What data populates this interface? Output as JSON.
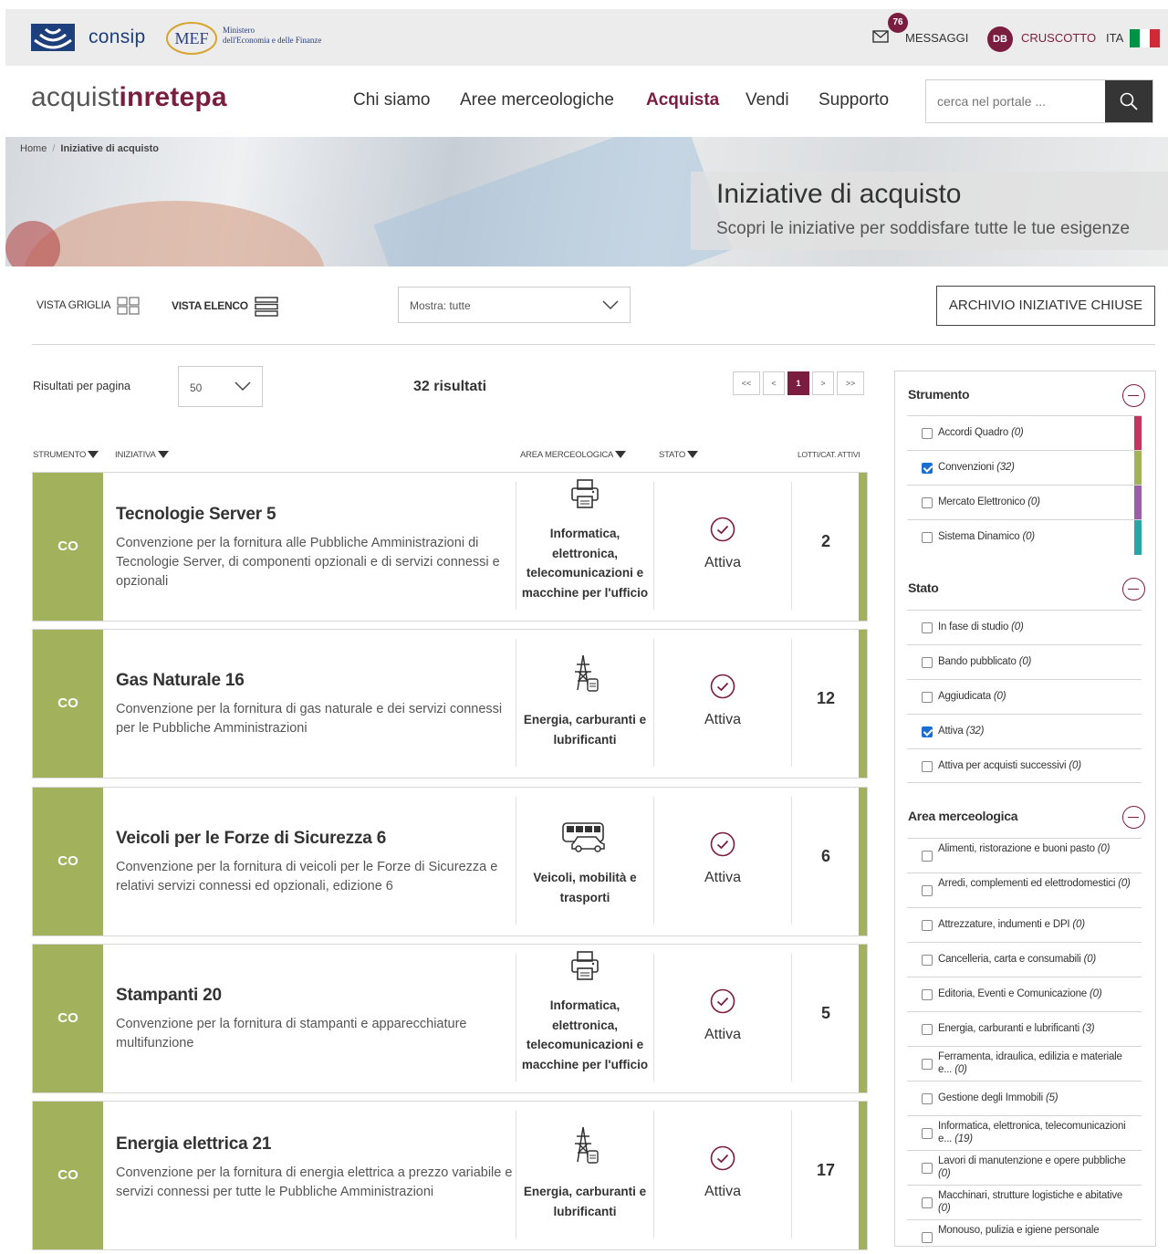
{
  "header": {
    "consip_text": "consip",
    "mef_abbr": "MEF",
    "mef_line1": "Ministero",
    "mef_line2": "dell'Economia e delle Finanze",
    "messages_count": "76",
    "messages_label": "MESSAGGI",
    "user_initials": "DB",
    "dashboard_label": "CRUSCOTTO",
    "language": "ITA",
    "flag_colors": [
      "#009246",
      "#ffffff",
      "#ce2b37"
    ]
  },
  "nav": {
    "brand_part1": "acquist",
    "brand_part2": "inrete",
    "brand_part3": "pa",
    "items": [
      {
        "label": "Chi siamo"
      },
      {
        "label": "Aree merceologiche"
      },
      {
        "label": "Acquista",
        "active": true
      },
      {
        "label": "Vendi"
      },
      {
        "label": "Supporto"
      }
    ],
    "search_placeholder": "cerca nel portale ..."
  },
  "breadcrumb": {
    "home": "Home",
    "current": "Iniziative di acquisto"
  },
  "hero": {
    "title": "Iniziative di acquisto",
    "subtitle": "Scopri le iniziative per soddisfare tutte le tue esigenze"
  },
  "toolbar": {
    "grid_view": "VISTA GRIGLIA",
    "list_view": "VISTA ELENCO",
    "show_select": "Mostra: tutte",
    "archive_button": "ARCHIVIO INIZIATIVE CHIUSE",
    "results_per_page_label": "Risultati per pagina",
    "results_per_page": "50",
    "results_count": "32 risultati",
    "pager": {
      "first": "<<",
      "prev": "<",
      "current": "1",
      "next": ">",
      "last": ">>"
    }
  },
  "columns": {
    "instrument": "STRUMENTO",
    "initiative": "INIZIATIVA",
    "area": "AREA MERCEOLOGICA",
    "status": "STATO",
    "lots": "LOTTI/CAT. ATTIVI"
  },
  "colors": {
    "accent": "#7a1d3e",
    "convenzioni": "#a2b25c",
    "accordi": "#c4365f",
    "mercato": "#9b5fa8",
    "sistema": "#2aa5a5"
  },
  "rows": [
    {
      "tag": "CO",
      "name": "Tecnologie Server 5",
      "desc": "Convenzione per la fornitura alle Pubbliche Amministrazioni di Tecnologie Server, di componenti opzionali e di servizi connessi e opzionali",
      "area": "Informatica, elettronica, telecomunicazioni e macchine per l'ufficio",
      "area_icon": "printer-icon",
      "status": "Attiva",
      "lots": "2"
    },
    {
      "tag": "CO",
      "name": "Gas Naturale 16",
      "desc": "Convenzione per la fornitura di gas naturale e dei servizi connessi per le Pubbliche Amministrazioni",
      "area": "Energia, carburanti e lubrificanti",
      "area_icon": "power-tower-icon",
      "status": "Attiva",
      "lots": "12"
    },
    {
      "tag": "CO",
      "name": "Veicoli per le Forze di Sicurezza 6",
      "desc": "Convenzione per la fornitura di veicoli per le Forze di Sicurezza e relativi servizi connessi ed opzionali, edizione 6",
      "area": "Veicoli, mobilità e trasporti",
      "area_icon": "bus-car-icon",
      "status": "Attiva",
      "lots": "6"
    },
    {
      "tag": "CO",
      "name": "Stampanti 20",
      "desc": "Convenzione per la fornitura di stampanti e apparecchiature multifunzione",
      "area": "Informatica, elettronica, telecomunicazioni e macchine per l'ufficio",
      "area_icon": "printer-icon",
      "status": "Attiva",
      "lots": "5"
    },
    {
      "tag": "CO",
      "name": "Energia elettrica 21",
      "desc": "Convenzione per la fornitura di energia elettrica a prezzo variabile e servizi connessi per tutte le Pubbliche Amministrazioni",
      "area": "Energia, carburanti e lubrificanti",
      "area_icon": "power-tower-icon",
      "status": "Attiva",
      "lots": "17"
    }
  ],
  "sidebar": {
    "instrument": {
      "title": "Strumento",
      "options": [
        {
          "label": "Accordi Quadro",
          "count": "(0)",
          "checked": false
        },
        {
          "label": "Convenzioni",
          "count": "(32)",
          "checked": true
        },
        {
          "label": "Mercato Elettronico",
          "count": "(0)",
          "checked": false
        },
        {
          "label": "Sistema Dinamico",
          "count": "(0)",
          "checked": false
        }
      ]
    },
    "status": {
      "title": "Stato",
      "options": [
        {
          "label": "In fase di studio",
          "count": "(0)",
          "checked": false
        },
        {
          "label": "Bando pubblicato",
          "count": "(0)",
          "checked": false
        },
        {
          "label": "Aggiudicata",
          "count": "(0)",
          "checked": false
        },
        {
          "label": "Attiva",
          "count": "(32)",
          "checked": true
        },
        {
          "label": "Attiva per acquisti successivi",
          "count": "(0)",
          "checked": false
        }
      ]
    },
    "area": {
      "title": "Area merceologica",
      "options": [
        {
          "label": "Alimenti, ristorazione e buoni pasto",
          "count": "(0)",
          "checked": false
        },
        {
          "label": "Arredi, complementi ed elettrodomestici",
          "count": "(0)",
          "checked": false
        },
        {
          "label": "Attrezzature, indumenti e DPI",
          "count": "(0)",
          "checked": false
        },
        {
          "label": "Cancelleria, carta e consumabili",
          "count": "(0)",
          "checked": false
        },
        {
          "label": "Editoria, Eventi e Comunicazione",
          "count": "(0)",
          "checked": false
        },
        {
          "label": "Energia, carburanti e lubrificanti",
          "count": "(3)",
          "checked": false
        },
        {
          "label": "Ferramenta, idraulica, edilizia e materiale e...",
          "count": "(0)",
          "checked": false
        },
        {
          "label": "Gestione degli Immobili",
          "count": "(5)",
          "checked": false
        },
        {
          "label": "Informatica, elettronica, telecomunicazioni e...",
          "count": "(19)",
          "checked": false
        },
        {
          "label": "Lavori di manutenzione e opere pubbliche",
          "count": "(0)",
          "checked": false
        },
        {
          "label": "Macchinari, strutture logistiche e abitative",
          "count": "(0)",
          "checked": false
        },
        {
          "label": "Monouso, pulizia e igiene personale",
          "count": "",
          "checked": false
        }
      ]
    }
  }
}
